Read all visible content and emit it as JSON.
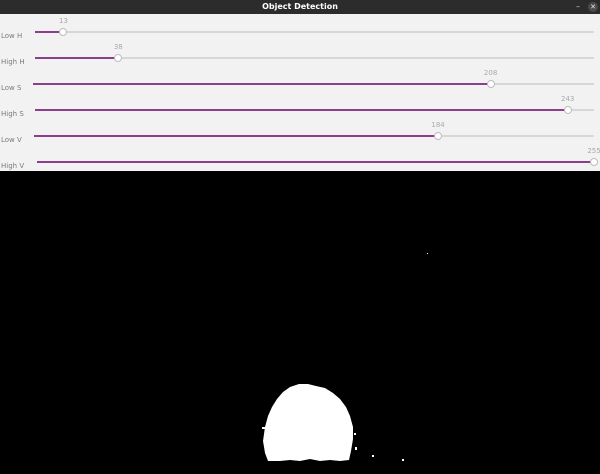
{
  "window": {
    "title": "Object Detection",
    "minimize_glyph": "–",
    "close_glyph": "✕"
  },
  "sliders": [
    {
      "label": "Low H",
      "value": "13",
      "max": 255
    },
    {
      "label": "High H",
      "value": "38",
      "max": 255
    },
    {
      "label": "Low S",
      "value": "208",
      "max": 255
    },
    {
      "label": "High S",
      "value": "243",
      "max": 255
    },
    {
      "label": "Low V",
      "value": "184",
      "max": 255
    },
    {
      "label": "High V",
      "value": "255",
      "max": 255
    }
  ],
  "colors": {
    "slider_fill": "#8a3e8c",
    "mask_background": "#000000",
    "mask_foreground": "#ffffff"
  }
}
